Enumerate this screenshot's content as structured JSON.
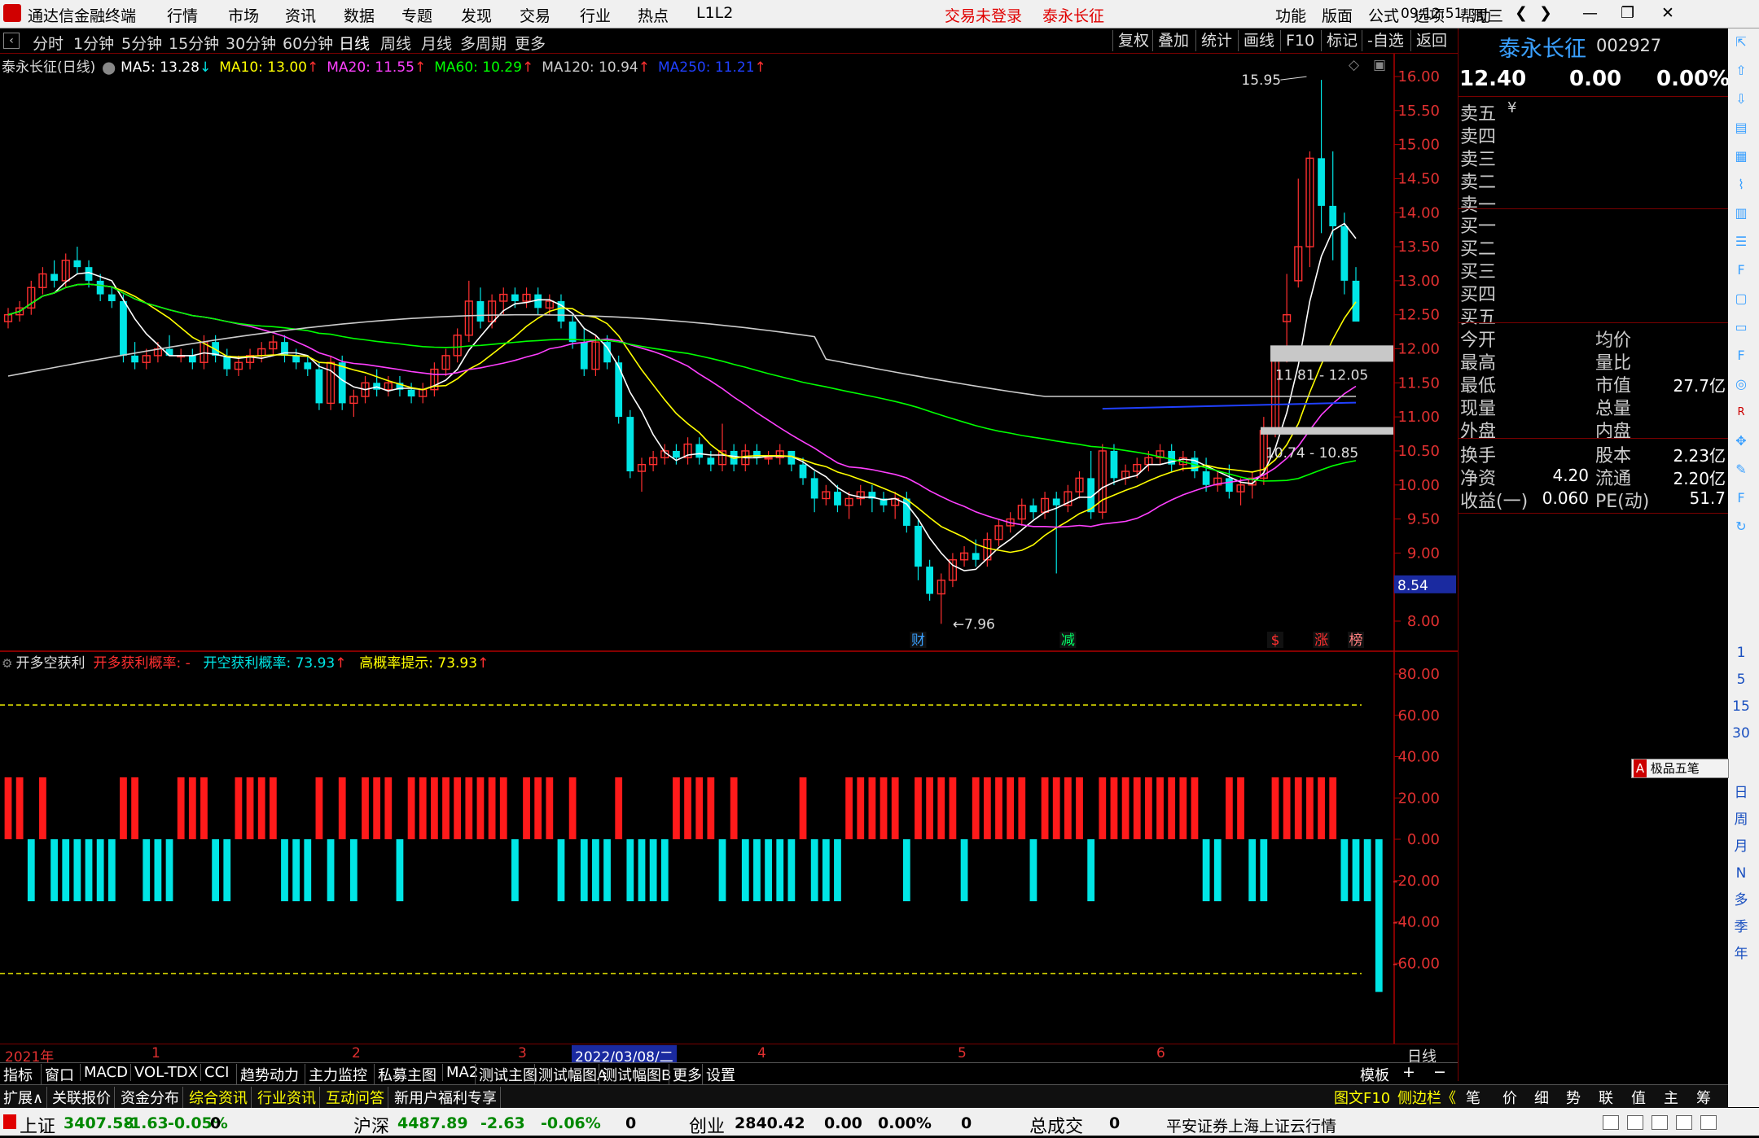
{
  "menubar": {
    "app_title": "通达信金融终端",
    "left_menu": [
      "行情",
      "市场",
      "资讯",
      "数据",
      "专题",
      "发现",
      "交易",
      "行业",
      "热点",
      "L1L2"
    ],
    "trade_status": "交易未登录",
    "stock_name": "泰永长征",
    "right_menu": [
      "功能",
      "版面",
      "公式",
      "选项",
      "帮助"
    ],
    "time": "09:12:51",
    "weekday": "周三"
  },
  "period_tabs": [
    "分时",
    "1分钟",
    "5分钟",
    "15分钟",
    "30分钟",
    "60分钟",
    "日线",
    "周线",
    "月线",
    "多周期",
    "更多"
  ],
  "chart_tools": [
    "复权",
    "叠加",
    "统计",
    "画线",
    "F10",
    "标记",
    "-自选",
    "返回"
  ],
  "ma_legend": {
    "title": "泰永长征(日线)",
    "items": [
      {
        "label": "MA5: 13.28",
        "arrow": "↓",
        "color": "#ffffff"
      },
      {
        "label": "MA10: 13.00",
        "arrow": "↑",
        "color": "#ffff00"
      },
      {
        "label": "MA20: 11.55",
        "arrow": "↑",
        "color": "#ff40ff"
      },
      {
        "label": "MA60: 10.29",
        "arrow": "↑",
        "color": "#00ff00"
      },
      {
        "label": "MA120: 10.94",
        "arrow": "↑",
        "color": "#cccccc"
      },
      {
        "label": "MA250: 11.21",
        "arrow": "↑",
        "color": "#2040ff"
      }
    ]
  },
  "price_axis": [
    "16.00",
    "15.50",
    "15.00",
    "14.50",
    "14.00",
    "13.50",
    "13.00",
    "12.50",
    "12.00",
    "11.50",
    "11.00",
    "10.50",
    "10.00",
    "9.50",
    "9.00",
    "8.50",
    "8.00"
  ],
  "price_marker": "8.54",
  "annotations": {
    "high": "15.95",
    "low": "7.96",
    "zone1": "11.81 - 12.05",
    "zone2": "10.74 - 10.85",
    "events": [
      "财",
      "减",
      "$",
      "涨",
      "榜"
    ]
  },
  "indicator": {
    "name": "开多空获利",
    "items": [
      {
        "label": "开多获利概率: -",
        "color": "#ff3030"
      },
      {
        "label": "开空获利概率: 73.93",
        "arrow": "↑",
        "color": "#00e5e5"
      },
      {
        "label": "高概率提示: 73.93",
        "arrow": "↑",
        "color": "#ffff00"
      }
    ],
    "axis": [
      "80.00",
      "60.00",
      "40.00",
      "20.00",
      "0.00",
      "-20.00",
      "-40.00",
      "-60.00"
    ]
  },
  "date_axis": {
    "labels": [
      "2021年",
      "1",
      "2",
      "3",
      "2022/03/08/二",
      "4",
      "5",
      "6"
    ],
    "period": "日线"
  },
  "indicator_tabs": [
    "指标",
    "窗口",
    "MACD",
    "VOL-TDX",
    "CCI",
    "趋势动力",
    "主力监控",
    "私募主图",
    "MA2",
    "测试主图",
    "测试幅图A",
    "测试幅图B",
    "更多",
    "设置"
  ],
  "template_label": "模板",
  "bottom_tabs": [
    {
      "label": "扩展∧",
      "color": "#ffffff"
    },
    {
      "label": "关联报价",
      "color": "#ffffff"
    },
    {
      "label": "资金分布",
      "color": "#ffffff"
    },
    {
      "label": "综合资讯",
      "color": "#ffff00"
    },
    {
      "label": "行业资讯",
      "color": "#ffff00"
    },
    {
      "label": "互动问答",
      "color": "#ffff00"
    },
    {
      "label": "新用户福利专享",
      "color": "#ffffff"
    }
  ],
  "bottom_right": [
    "图文F10",
    "侧边栏《",
    "笔",
    "价",
    "细",
    "势",
    "联",
    "值",
    "主",
    "筹"
  ],
  "quote_panel": {
    "name": "泰永长征",
    "code": "002927",
    "price": "12.40",
    "change": "0.00",
    "change_pct": "0.00%",
    "sell_levels": [
      "卖五",
      "卖四",
      "卖三",
      "卖二",
      "卖一"
    ],
    "buy_levels": [
      "买一",
      "买二",
      "买三",
      "买四",
      "买五"
    ],
    "currency_mark": "¥",
    "stats": [
      {
        "l": "今开",
        "lv": "",
        "r": "均价",
        "rv": ""
      },
      {
        "l": "最高",
        "lv": "",
        "r": "量比",
        "rv": ""
      },
      {
        "l": "最低",
        "lv": "",
        "r": "市值",
        "rv": "27.7亿"
      },
      {
        "l": "现量",
        "lv": "",
        "r": "总量",
        "rv": ""
      },
      {
        "l": "外盘",
        "lv": "",
        "r": "内盘",
        "rv": ""
      }
    ],
    "stats2": [
      {
        "l": "换手",
        "lv": "",
        "r": "股本",
        "rv": "2.23亿"
      },
      {
        "l": "净资",
        "lv": "4.20",
        "r": "流通",
        "rv": "2.20亿"
      },
      {
        "l": "收益(一)",
        "lv": "0.060",
        "r": "PE(动)",
        "rv": "51.7"
      }
    ],
    "ime_label": "极品五笔"
  },
  "side_toolbar": [
    "1",
    "5",
    "15",
    "30",
    "日",
    "周",
    "月",
    "N",
    "多",
    "季",
    "年"
  ],
  "status_bar": [
    {
      "name": "上证",
      "value": "3407.58",
      "chg": "-1.63",
      "pct": "-0.05%",
      "vol": "0"
    },
    {
      "name": "沪深",
      "value": "4487.89",
      "chg": "-2.63",
      "pct": "-0.06%",
      "vol": "0"
    },
    {
      "name": "创业",
      "value": "2840.42",
      "chg": "0.00",
      "pct": "0.00%",
      "vol": "0"
    },
    {
      "name": "总成交",
      "value": "0"
    }
  ],
  "status_right": "平安证券上海上证云行情",
  "colors": {
    "up": "#ff3030",
    "down": "#00e5e5",
    "axis": "#b00000",
    "ma5": "#ffffff",
    "ma10": "#ffff00",
    "ma20": "#ff40ff",
    "ma60": "#00ff00",
    "ma120": "#cccccc",
    "ma250": "#2040ff"
  },
  "chart_data": {
    "type": "candlestick",
    "y_range": [
      7.8,
      16.2
    ],
    "candles": [
      [
        12.4,
        12.6,
        12.3,
        12.5
      ],
      [
        12.5,
        12.7,
        12.4,
        12.6
      ],
      [
        12.6,
        13.0,
        12.5,
        12.9
      ],
      [
        12.9,
        13.2,
        12.8,
        13.1
      ],
      [
        13.1,
        13.3,
        12.9,
        13.0
      ],
      [
        13.0,
        13.4,
        12.9,
        13.3
      ],
      [
        13.3,
        13.5,
        13.1,
        13.2
      ],
      [
        13.2,
        13.3,
        12.9,
        13.0
      ],
      [
        13.0,
        13.1,
        12.7,
        12.8
      ],
      [
        12.8,
        12.9,
        12.6,
        12.7
      ],
      [
        12.7,
        12.8,
        11.8,
        11.9
      ],
      [
        11.9,
        12.1,
        11.7,
        11.8
      ],
      [
        11.8,
        12.0,
        11.7,
        11.9
      ],
      [
        11.9,
        12.1,
        11.8,
        12.0
      ],
      [
        12.0,
        12.2,
        11.9,
        11.9
      ],
      [
        11.9,
        12.0,
        11.8,
        11.9
      ],
      [
        11.9,
        12.0,
        11.7,
        11.8
      ],
      [
        11.8,
        12.2,
        11.7,
        12.1
      ],
      [
        12.1,
        12.2,
        11.8,
        11.9
      ],
      [
        11.9,
        12.0,
        11.6,
        11.7
      ],
      [
        11.7,
        11.9,
        11.6,
        11.8
      ],
      [
        11.8,
        12.0,
        11.7,
        11.9
      ],
      [
        11.9,
        12.1,
        11.8,
        12.0
      ],
      [
        12.0,
        12.2,
        11.9,
        12.1
      ],
      [
        12.1,
        12.2,
        11.8,
        11.9
      ],
      [
        11.9,
        12.0,
        11.7,
        11.8
      ],
      [
        11.8,
        11.9,
        11.6,
        11.7
      ],
      [
        11.7,
        11.8,
        11.1,
        11.2
      ],
      [
        11.2,
        11.9,
        11.1,
        11.8
      ],
      [
        11.8,
        11.9,
        11.1,
        11.2
      ],
      [
        11.2,
        11.4,
        11.0,
        11.3
      ],
      [
        11.3,
        11.6,
        11.2,
        11.5
      ],
      [
        11.5,
        11.7,
        11.3,
        11.4
      ],
      [
        11.4,
        11.6,
        11.3,
        11.5
      ],
      [
        11.5,
        11.6,
        11.3,
        11.4
      ],
      [
        11.4,
        11.5,
        11.2,
        11.3
      ],
      [
        11.3,
        11.5,
        11.2,
        11.4
      ],
      [
        11.4,
        11.8,
        11.3,
        11.7
      ],
      [
        11.7,
        12.0,
        11.6,
        11.9
      ],
      [
        11.9,
        12.3,
        11.8,
        12.2
      ],
      [
        12.2,
        13.0,
        12.1,
        12.7
      ],
      [
        12.7,
        12.9,
        12.3,
        12.4
      ],
      [
        12.4,
        12.8,
        12.3,
        12.7
      ],
      [
        12.7,
        12.9,
        12.5,
        12.8
      ],
      [
        12.8,
        12.9,
        12.6,
        12.7
      ],
      [
        12.7,
        12.9,
        12.6,
        12.8
      ],
      [
        12.8,
        12.9,
        12.5,
        12.6
      ],
      [
        12.6,
        12.8,
        12.5,
        12.7
      ],
      [
        12.7,
        12.8,
        12.3,
        12.4
      ],
      [
        12.4,
        12.5,
        12.0,
        12.1
      ],
      [
        12.1,
        12.3,
        11.6,
        11.7
      ],
      [
        11.7,
        12.2,
        11.6,
        12.1
      ],
      [
        12.1,
        12.2,
        11.7,
        11.8
      ],
      [
        11.8,
        11.9,
        10.9,
        11.0
      ],
      [
        11.0,
        11.1,
        10.1,
        10.2
      ],
      [
        10.2,
        10.4,
        9.9,
        10.3
      ],
      [
        10.3,
        10.5,
        10.2,
        10.4
      ],
      [
        10.4,
        10.6,
        10.3,
        10.5
      ],
      [
        10.5,
        10.6,
        10.3,
        10.4
      ],
      [
        10.4,
        10.7,
        10.3,
        10.6
      ],
      [
        10.6,
        10.7,
        10.3,
        10.4
      ],
      [
        10.4,
        10.5,
        10.2,
        10.3
      ],
      [
        10.3,
        10.9,
        10.2,
        10.5
      ],
      [
        10.5,
        10.6,
        10.2,
        10.3
      ],
      [
        10.3,
        10.6,
        10.2,
        10.5
      ],
      [
        10.5,
        10.6,
        10.3,
        10.4
      ],
      [
        10.4,
        10.5,
        10.3,
        10.4
      ],
      [
        10.4,
        10.6,
        10.3,
        10.5
      ],
      [
        10.5,
        10.5,
        10.2,
        10.3
      ],
      [
        10.3,
        10.4,
        10.0,
        10.1
      ],
      [
        10.1,
        10.2,
        9.6,
        9.8
      ],
      [
        9.8,
        10.0,
        9.7,
        9.9
      ],
      [
        9.9,
        10.0,
        9.6,
        9.7
      ],
      [
        9.7,
        9.9,
        9.5,
        9.8
      ],
      [
        9.8,
        10.0,
        9.7,
        9.9
      ],
      [
        9.9,
        10.0,
        9.6,
        9.8
      ],
      [
        9.8,
        9.9,
        9.6,
        9.7
      ],
      [
        9.7,
        9.9,
        9.5,
        9.8
      ],
      [
        9.8,
        9.9,
        9.3,
        9.4
      ],
      [
        9.4,
        9.5,
        8.6,
        8.8
      ],
      [
        8.8,
        8.9,
        8.3,
        8.4
      ],
      [
        8.4,
        8.7,
        7.96,
        8.6
      ],
      [
        8.6,
        9.0,
        8.5,
        8.9
      ],
      [
        8.9,
        9.1,
        8.8,
        9.0
      ],
      [
        9.0,
        9.2,
        8.8,
        8.9
      ],
      [
        8.9,
        9.3,
        8.8,
        9.2
      ],
      [
        9.2,
        9.5,
        9.1,
        9.4
      ],
      [
        9.4,
        9.6,
        9.3,
        9.5
      ],
      [
        9.5,
        9.8,
        9.4,
        9.7
      ],
      [
        9.7,
        9.8,
        9.5,
        9.6
      ],
      [
        9.6,
        9.9,
        9.5,
        9.8
      ],
      [
        9.8,
        9.9,
        8.7,
        9.7
      ],
      [
        9.7,
        10.0,
        9.6,
        9.9
      ],
      [
        9.9,
        10.2,
        9.8,
        10.1
      ],
      [
        10.1,
        10.5,
        9.5,
        9.6
      ],
      [
        9.6,
        10.6,
        9.5,
        10.5
      ],
      [
        10.5,
        10.6,
        10.0,
        10.1
      ],
      [
        10.1,
        10.3,
        10.0,
        10.2
      ],
      [
        10.2,
        10.4,
        10.1,
        10.3
      ],
      [
        10.3,
        10.5,
        10.2,
        10.4
      ],
      [
        10.4,
        10.6,
        10.3,
        10.5
      ],
      [
        10.5,
        10.6,
        10.2,
        10.3
      ],
      [
        10.3,
        10.5,
        10.2,
        10.4
      ],
      [
        10.4,
        10.5,
        10.1,
        10.2
      ],
      [
        10.2,
        10.4,
        9.9,
        10.0
      ],
      [
        10.0,
        10.2,
        9.9,
        10.1
      ],
      [
        10.1,
        10.3,
        9.8,
        9.9
      ],
      [
        9.9,
        10.1,
        9.7,
        10.0
      ],
      [
        10.0,
        10.2,
        9.8,
        10.1
      ],
      [
        10.1,
        11.0,
        10.0,
        10.8
      ],
      [
        10.8,
        11.9,
        10.7,
        11.9
      ],
      [
        12.4,
        13.1,
        11.8,
        12.5
      ],
      [
        13.0,
        14.5,
        12.9,
        13.5
      ],
      [
        13.5,
        14.9,
        13.2,
        14.8
      ],
      [
        14.8,
        15.95,
        13.7,
        14.1
      ],
      [
        14.1,
        14.9,
        13.3,
        13.8
      ],
      [
        13.8,
        14.0,
        12.8,
        13.0
      ],
      [
        13.0,
        13.2,
        12.4,
        12.4
      ]
    ],
    "indicator_values": [
      30,
      30,
      -30,
      30,
      -30,
      -30,
      -30,
      -30,
      -30,
      -30,
      30,
      30,
      -30,
      -30,
      -30,
      30,
      30,
      30,
      -30,
      -30,
      30,
      30,
      30,
      30,
      -30,
      -30,
      -30,
      30,
      -30,
      30,
      -30,
      30,
      30,
      30,
      -30,
      30,
      30,
      30,
      30,
      30,
      30,
      30,
      30,
      30,
      -30,
      30,
      30,
      30,
      -30,
      30,
      -30,
      -30,
      -30,
      30,
      -30,
      -30,
      -30,
      -30,
      30,
      30,
      30,
      30,
      -30,
      30,
      -30,
      -30,
      -30,
      -30,
      -30,
      30,
      -30,
      -30,
      -30,
      30,
      30,
      30,
      30,
      30,
      -30,
      30,
      30,
      30,
      30,
      -30,
      30,
      30,
      30,
      30,
      30,
      -30,
      30,
      30,
      30,
      30,
      -30,
      30,
      30,
      30,
      30,
      30,
      30,
      30,
      30,
      30,
      -30,
      -30,
      30,
      30,
      -30,
      -30,
      30,
      30,
      30,
      30,
      30,
      30,
      -30,
      -30,
      -30,
      -73.93
    ]
  }
}
